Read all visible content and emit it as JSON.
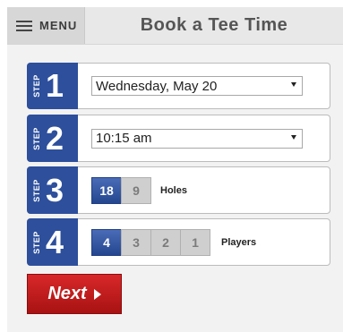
{
  "header": {
    "menu_label": "MENU",
    "title": "Book a Tee Time"
  },
  "steps": [
    {
      "word": "STEP",
      "number": "1",
      "select_value": "Wednesday, May 20"
    },
    {
      "word": "STEP",
      "number": "2",
      "select_value": "10:15 am"
    },
    {
      "word": "STEP",
      "number": "3",
      "options": [
        "18",
        "9"
      ],
      "selected": "18",
      "label": "Holes"
    },
    {
      "word": "STEP",
      "number": "4",
      "options": [
        "4",
        "3",
        "2",
        "1"
      ],
      "selected": "4",
      "label": "Players"
    }
  ],
  "next_button": {
    "label": "Next"
  },
  "colors": {
    "step_badge": "#2d4f9c",
    "active_option": "#2d4f9c",
    "next_button": "#c01c1c"
  },
  "icons": [
    "hamburger-menu-icon",
    "dropdown-arrow-icon",
    "play-arrow-icon"
  ]
}
